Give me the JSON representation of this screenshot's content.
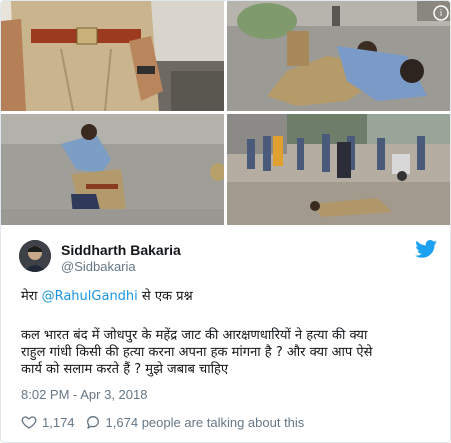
{
  "tweet": {
    "author_name": "Siddharth Bakaria",
    "author_handle": "@Sidbakaria",
    "line1_prefix": "मेरा ",
    "line1_mention": "@RahulGandhi",
    "line1_suffix": " से एक प्रश्न",
    "line2": "कल भारत बंद में जोधपुर के महेंद्र जाट की आरक्षणधारियों ने हत्या की क्या",
    "line3": "राहुल गांधी किसी की हत्या करना अपना हक मांगना है ? और क्या आप ऐसे",
    "line4": "कार्य को सलाम करते हैं ? मुझे जबाब चाहिए",
    "timestamp": "8:02 PM - Apr 3, 2018",
    "likes": "1,174",
    "talking": "1,674 people are talking about this"
  },
  "media": {
    "photos": [
      {
        "icon": "policeman-belt-photo"
      },
      {
        "icon": "policeman-on-ground-photo"
      },
      {
        "icon": "policeman-lying-photo"
      },
      {
        "icon": "street-crowd-photo"
      }
    ]
  },
  "icons": {
    "brand": "twitter-bird-icon",
    "like": "heart-icon",
    "reply": "speech-bubble-icon"
  },
  "colors": {
    "mention": "#1b95e0",
    "twitter_blue": "#1da1f2",
    "meta_gray": "#657786",
    "text": "#14171a"
  }
}
